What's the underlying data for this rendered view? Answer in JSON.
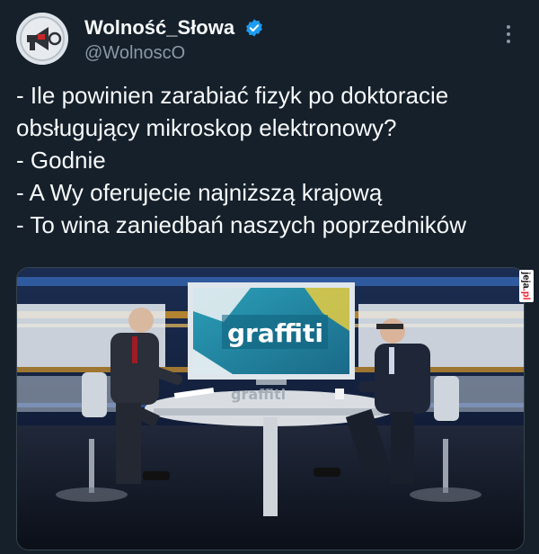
{
  "author": {
    "display_name": "Wolność_Słowa",
    "handle": "@WolnoscO",
    "verified": true
  },
  "tweet": {
    "lines": [
      "- Ile powinien zarabiać fizyk po doktoracie",
      "obsługujący mikroskop elektronowy?",
      "- Godnie",
      "- A Wy oferujecie najniższą krajową",
      "- To wina zaniedbań naszych poprzedników"
    ]
  },
  "media": {
    "screen_logo": "graffiti",
    "desk_text": "graffiti"
  },
  "watermark": {
    "text": "jeja",
    "suffix": ".pl"
  },
  "colors": {
    "background": "#15202b",
    "verified_badge": "#1d9bf0",
    "muted_text": "#8b98a5"
  },
  "icons": {
    "more": "more-vertical-icon",
    "verified": "verified-badge-icon",
    "avatar": "megaphone-icon"
  }
}
